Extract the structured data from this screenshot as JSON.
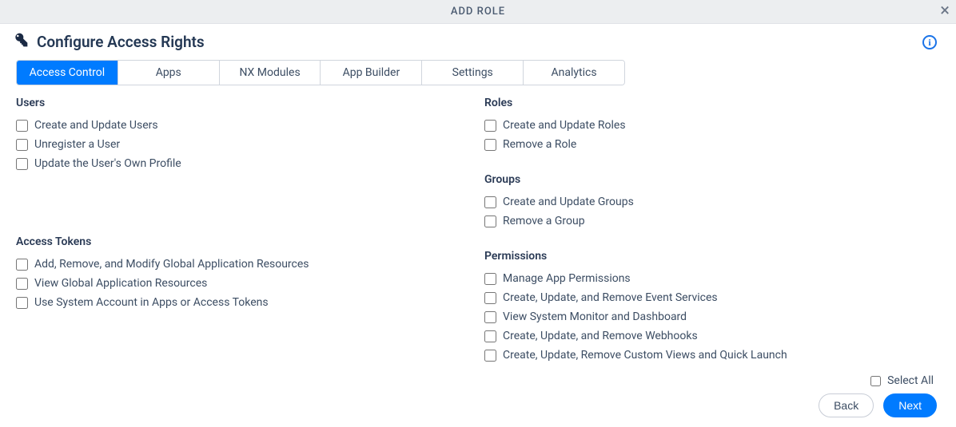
{
  "dialogTitle": "ADD ROLE",
  "pageTitle": "Configure Access Rights",
  "tabs": [
    {
      "label": "Access Control",
      "active": true
    },
    {
      "label": "Apps"
    },
    {
      "label": "NX Modules"
    },
    {
      "label": "App Builder"
    },
    {
      "label": "Settings"
    },
    {
      "label": "Analytics"
    }
  ],
  "leftSections": [
    {
      "title": "Users",
      "tall": true,
      "checks": [
        "Create and Update Users",
        "Unregister a User",
        "Update the User's Own Profile"
      ]
    },
    {
      "title": "Access Tokens",
      "checks": [
        "Add, Remove, and Modify Global Application Resources",
        "View Global Application Resources",
        "Use System Account in Apps or Access Tokens"
      ]
    }
  ],
  "rightSections": [
    {
      "title": "Roles",
      "checks": [
        "Create and Update Roles",
        "Remove a Role"
      ]
    },
    {
      "title": "Groups",
      "checks": [
        "Create and Update Groups",
        "Remove a Group"
      ]
    },
    {
      "title": "Permissions",
      "checks": [
        "Manage App Permissions",
        "Create, Update, and Remove Event Services",
        "View System Monitor and Dashboard",
        "Create, Update, and Remove Webhooks",
        "Create, Update, Remove Custom Views and Quick Launch"
      ]
    }
  ],
  "selectAllLabel": "Select All",
  "backLabel": "Back",
  "nextLabel": "Next"
}
